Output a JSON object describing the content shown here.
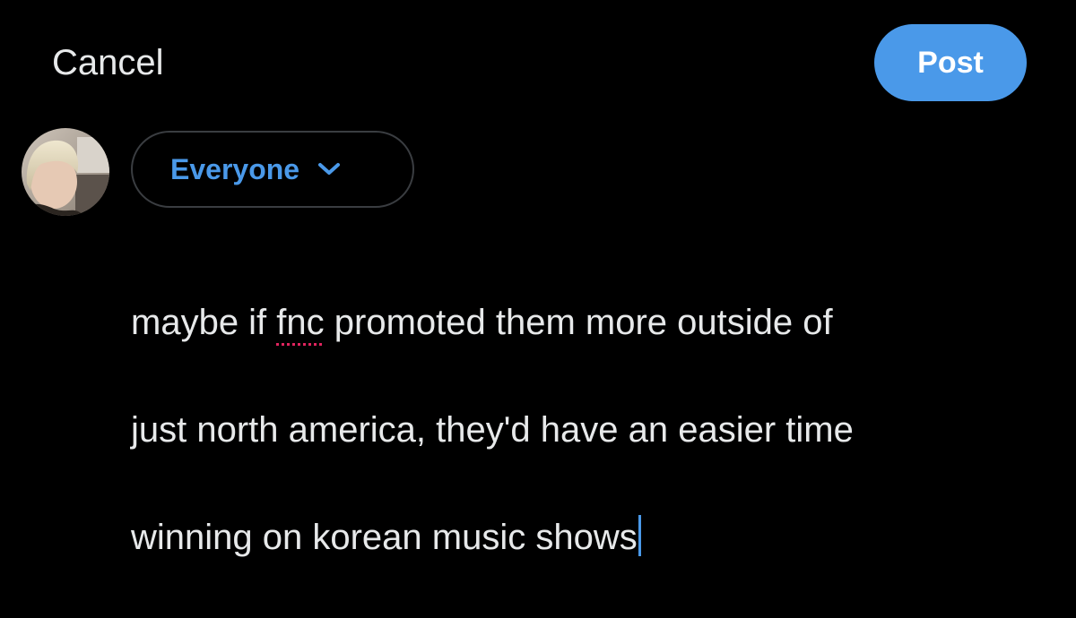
{
  "header": {
    "cancel_label": "Cancel",
    "post_label": "Post"
  },
  "audience": {
    "label": "Everyone",
    "icon": "chevron-down-icon"
  },
  "composer": {
    "line1_before": "maybe if ",
    "line1_misspelled": "fnc",
    "line1_after": " promoted them more outside of",
    "line2": "just north america, they'd have an easier time",
    "line3": "winning on korean music shows"
  },
  "colors": {
    "accent": "#4a99e9",
    "background": "#000000",
    "text": "#e7e9ea",
    "border": "#3a3d41",
    "spellcheck": "#e0245e"
  }
}
